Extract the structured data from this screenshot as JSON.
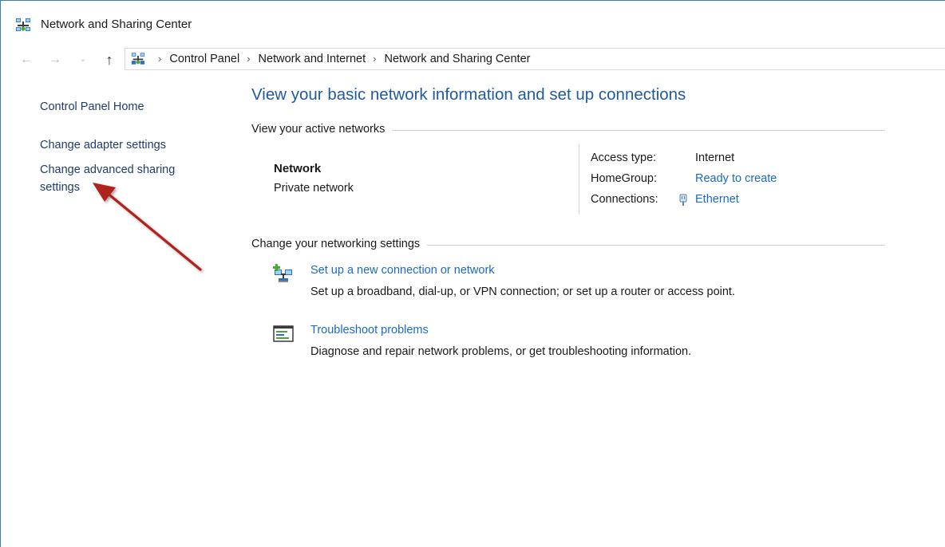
{
  "window": {
    "title": "Network and Sharing Center"
  },
  "nav": {
    "back": "←",
    "forward": "→",
    "recent": "⌄",
    "up": "↑",
    "breadcrumbs": [
      "Control Panel",
      "Network and Internet",
      "Network and Sharing Center"
    ],
    "separator": "›"
  },
  "sidebar": {
    "items": [
      {
        "label": "Control Panel Home"
      },
      {
        "label": "Change adapter settings"
      },
      {
        "label": "Change advanced sharing settings"
      }
    ]
  },
  "main": {
    "title": "View your basic network information and set up connections",
    "active_networks": {
      "header": "View your active networks",
      "network_name": "Network",
      "network_type": "Private network",
      "access_type_label": "Access type:",
      "access_type_value": "Internet",
      "homegroup_label": "HomeGroup:",
      "homegroup_value": "Ready to create",
      "connections_label": "Connections:",
      "connections_value": "Ethernet"
    },
    "networking_settings": {
      "header": "Change your networking settings",
      "tasks": [
        {
          "icon": "new-connection-icon",
          "link": "Set up a new connection or network",
          "description": "Set up a broadband, dial-up, or VPN connection; or set up a router or access point."
        },
        {
          "icon": "troubleshoot-icon",
          "link": "Troubleshoot problems",
          "description": "Diagnose and repair network problems, or get troubleshooting information."
        }
      ]
    }
  },
  "colors": {
    "link": "#1b6ac1",
    "title": "#1e5a9c",
    "sidebar_link": "#1f3c6b",
    "annotation_arrow": "#b0201e"
  }
}
